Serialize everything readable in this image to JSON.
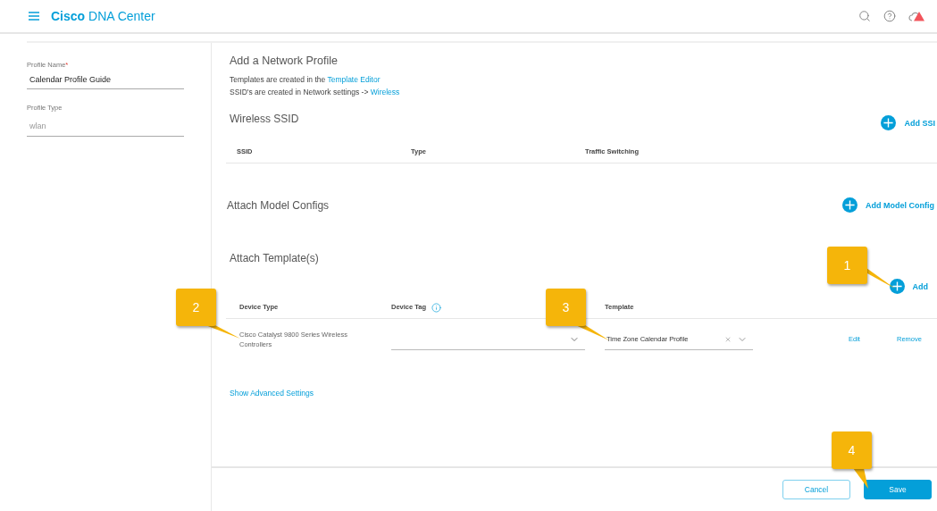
{
  "header": {
    "brand_bold": "Cisco",
    "brand_rest": "DNA Center"
  },
  "profile_fields": [
    {
      "label": "Profile Name",
      "required_mark": "*",
      "value": "Calendar Profile Guide",
      "disabled": false
    },
    {
      "label": "Profile Type",
      "value": "wlan",
      "disabled": true
    }
  ],
  "main": {
    "title": "Add a Network Profile",
    "info_lines": [
      {
        "text": "Templates are created in the ",
        "link": "Template Editor"
      },
      {
        "text": "SSID's are created in Network settings -> ",
        "link": "Wireless"
      }
    ],
    "wireless_ssid": {
      "title": "Wireless SSID",
      "add_label": "Add SSI",
      "columns": [
        "SSID",
        "Type",
        "Traffic Switching"
      ]
    },
    "model_configs": {
      "title": "Attach Model Configs",
      "add_label": "Add Model Config"
    },
    "templates": {
      "title": "Attach Template(s)",
      "add_label": "Add",
      "columns": [
        {
          "label": "Device Type",
          "info": false
        },
        {
          "label": "Device Tag",
          "info": true
        },
        {
          "label": "Template",
          "info": false
        }
      ],
      "rows": [
        {
          "device_type": "Cisco Catalyst 9800 Series Wireless Controllers",
          "template": "Time Zone Calendar Profile",
          "actions": [
            "Edit",
            "Remove"
          ]
        }
      ]
    },
    "advanced_link": "Show Advanced Settings"
  },
  "footer_buttons": [
    {
      "label": "Cancel",
      "kind": "secondary"
    },
    {
      "label": "Save",
      "kind": "primary"
    }
  ],
  "callouts": [
    {
      "number": "1"
    },
    {
      "number": "2"
    },
    {
      "number": "3"
    },
    {
      "number": "4"
    }
  ]
}
